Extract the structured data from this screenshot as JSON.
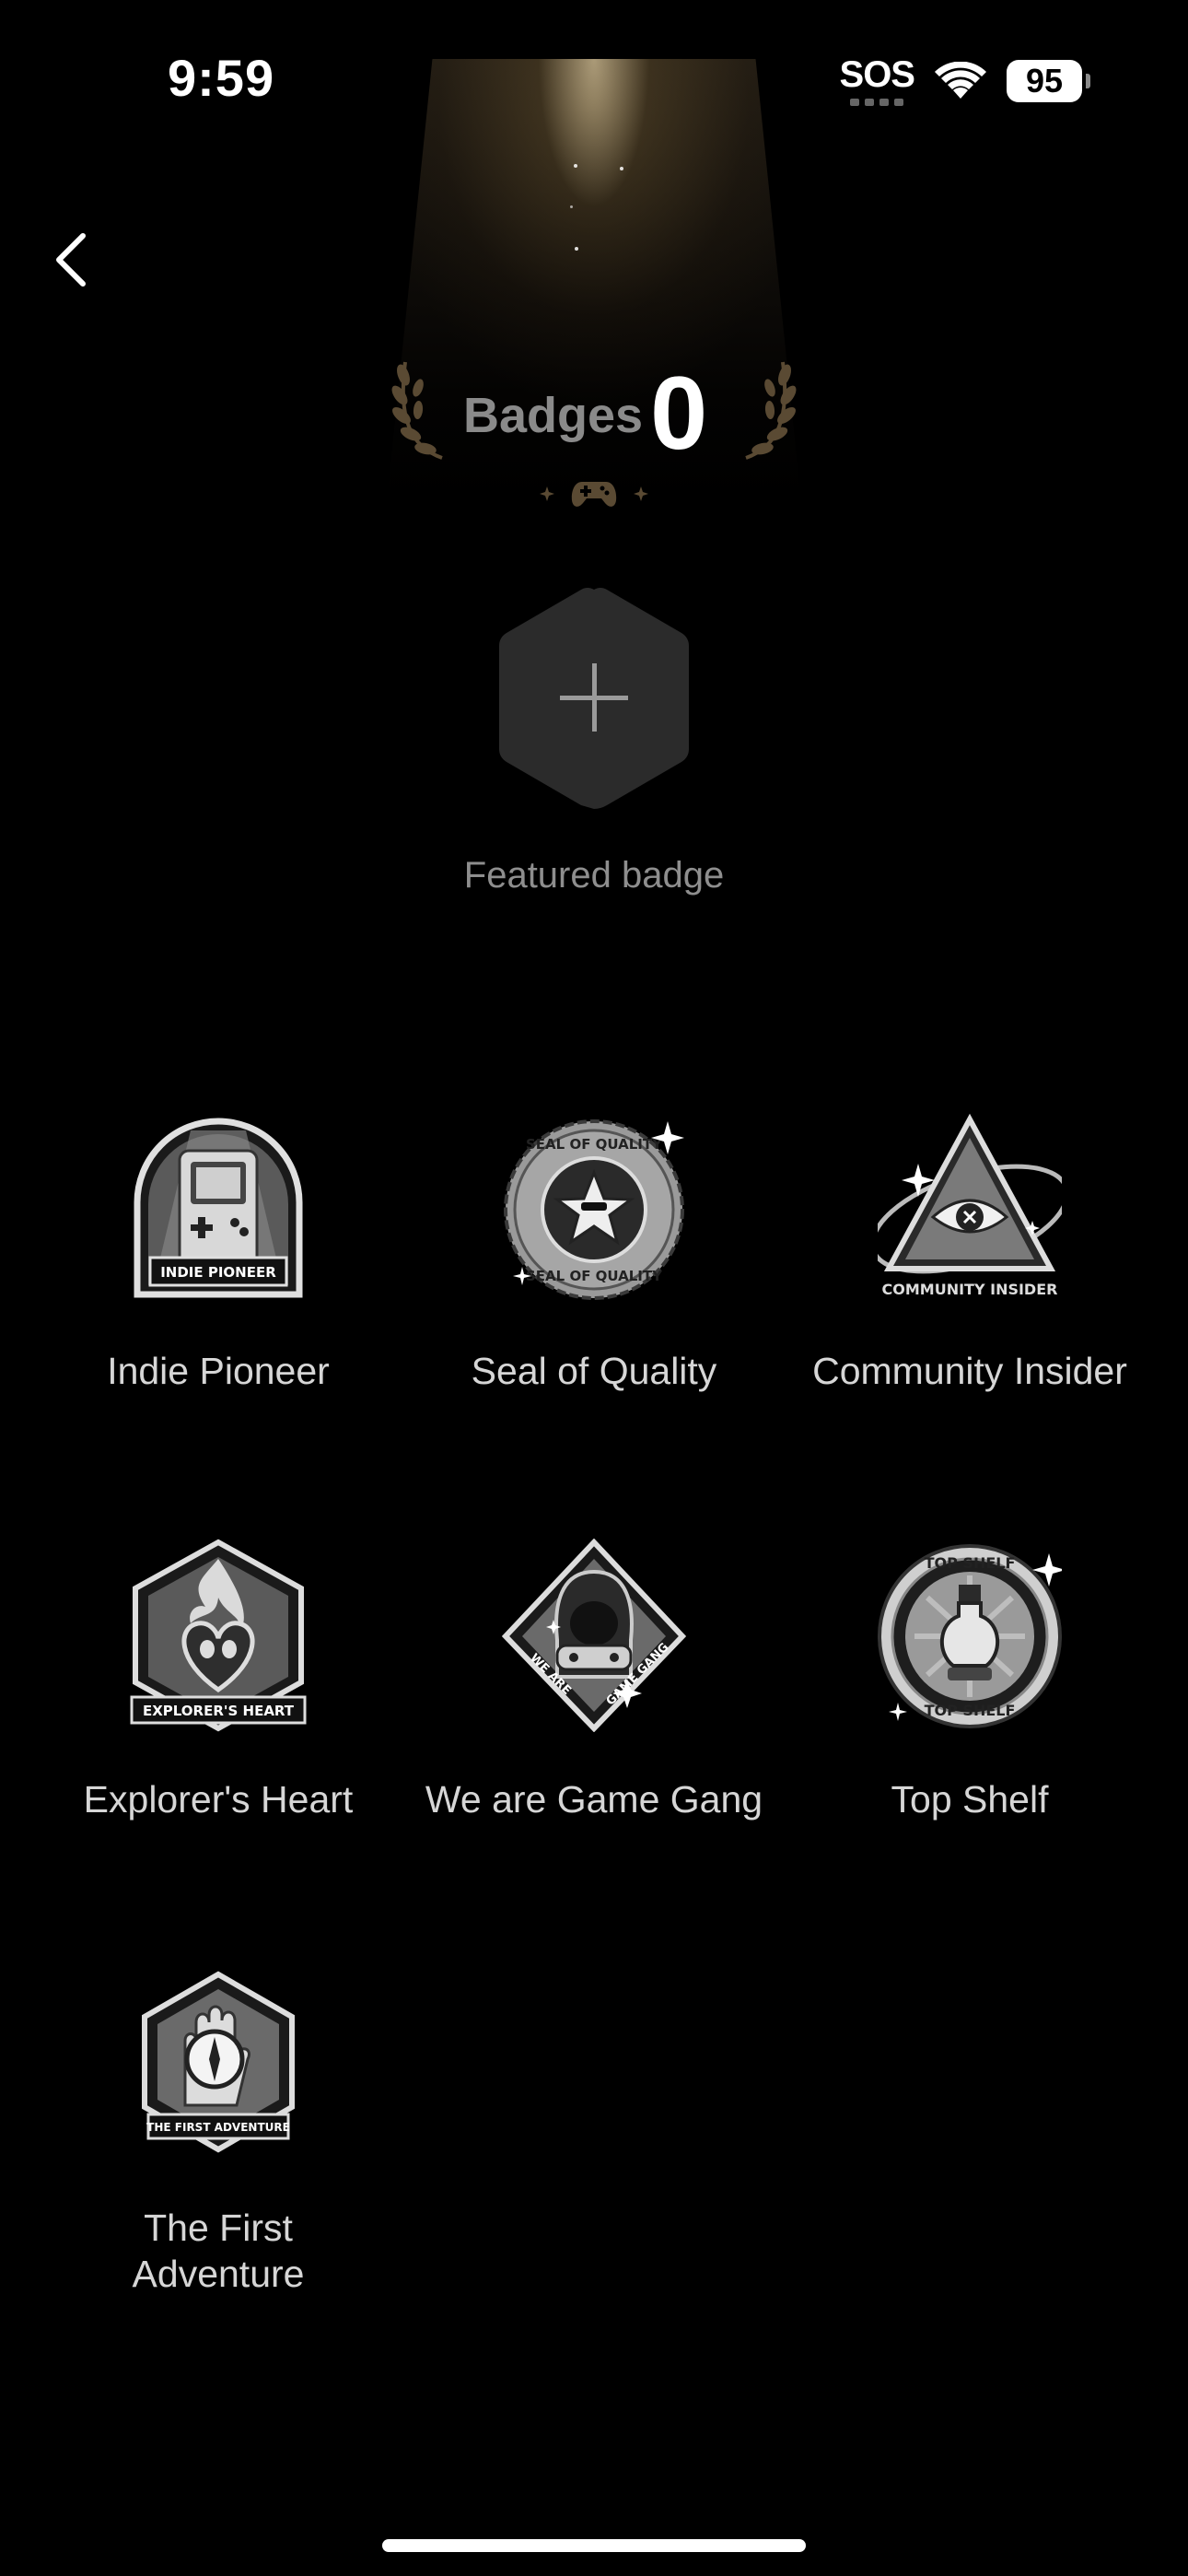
{
  "status_bar": {
    "time": "9:59",
    "sos": "SOS",
    "battery": "95",
    "wifi_icon": "wifi-icon"
  },
  "header": {
    "back_icon": "chevron-left-icon",
    "title": "Badges",
    "count": "0",
    "decor_icon": "gamepad-icon",
    "accent_color": "#5a4a33"
  },
  "featured": {
    "label": "Featured badge",
    "icon": "plus-icon"
  },
  "badges": [
    {
      "label": "Indie Pioneer",
      "emblem_text": "INDIE PIONEER",
      "icon": "handheld-console-badge-icon"
    },
    {
      "label": "Seal of Quality",
      "emblem_text": "SEAL OF QUALITY",
      "icon": "star-seal-badge-icon"
    },
    {
      "label": "Community Insider",
      "emblem_text": "COMMUNITY INSIDER",
      "icon": "pyramid-eye-badge-icon"
    },
    {
      "label": "Explorer's Heart",
      "emblem_text": "EXPLORER'S HEART",
      "icon": "flaming-heart-badge-icon"
    },
    {
      "label": "We are Game Gang",
      "emblem_text": "WE ARE GAME GANG",
      "icon": "hooded-figure-badge-icon"
    },
    {
      "label": "Top Shelf",
      "emblem_text": "TOP SHELF",
      "icon": "potion-bottle-badge-icon"
    },
    {
      "label": "The First Adventure",
      "emblem_text": "THE FIRST ADVENTURE",
      "icon": "compass-hand-badge-icon"
    }
  ]
}
